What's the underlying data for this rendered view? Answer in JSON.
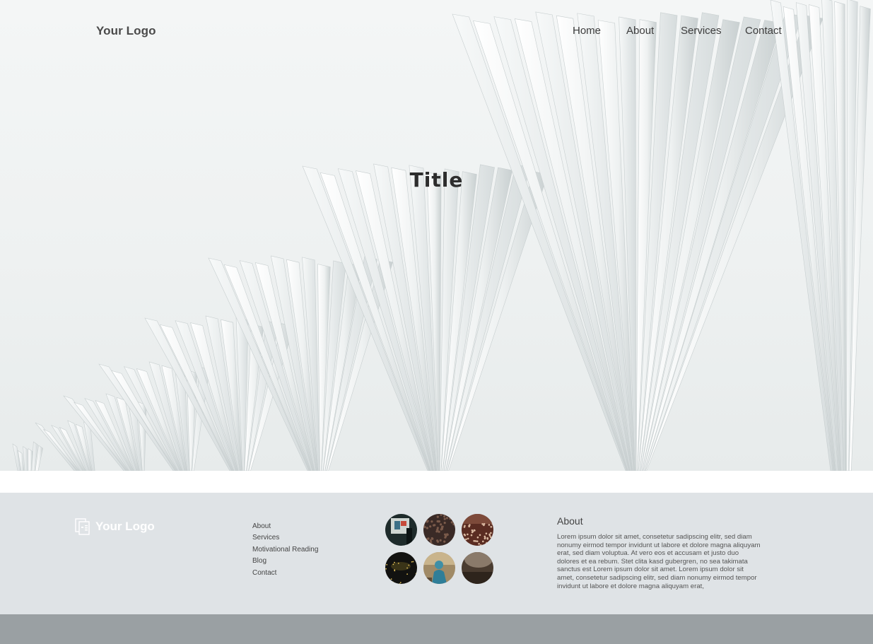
{
  "header": {
    "logo_text": "Your Logo",
    "nav": [
      {
        "label": "Home"
      },
      {
        "label": "About"
      },
      {
        "label": "Services"
      },
      {
        "label": "Contact"
      }
    ]
  },
  "hero": {
    "title": "Title",
    "background_icon": "white-fan-architecture-photo"
  },
  "footer": {
    "logo_text": "Your Logo",
    "logo_icon": "document-icon",
    "links": [
      {
        "label": "About"
      },
      {
        "label": "Services"
      },
      {
        "label": "Motivational Reading"
      },
      {
        "label": "Blog"
      },
      {
        "label": "Contact"
      }
    ],
    "gallery": [
      {
        "icon": "presentation-photo",
        "color": "#1e2b2b"
      },
      {
        "icon": "crowd-photo",
        "color": "#3a2a26"
      },
      {
        "icon": "audience-photo",
        "color": "#5a2c22"
      },
      {
        "icon": "concert-photo",
        "color": "#121210"
      },
      {
        "icon": "speaker-photo",
        "color": "#a08a66"
      },
      {
        "icon": "auditorium-photo",
        "color": "#4a3c30"
      }
    ],
    "about": {
      "heading": "About",
      "text": "Lorem ipsum dolor sit amet, consetetur sadipscing elitr, sed diam nonumy eirmod tempor invidunt ut labore et dolore magna aliquyam erat, sed diam voluptua. At vero eos et accusam et justo duo dolores et ea rebum. Stet clita kasd gubergren, no sea takimata sanctus est Lorem ipsum dolor sit amet. Lorem ipsum dolor sit amet, consetetur sadipscing elitr, sed diam nonumy eirmod tempor invidunt ut labore et dolore magna aliquyam erat,"
    }
  },
  "colors": {
    "footer_bg": "#dfe3e6",
    "bottom_bar": "#9aa0a3",
    "text_dark": "#3d3d3d"
  }
}
